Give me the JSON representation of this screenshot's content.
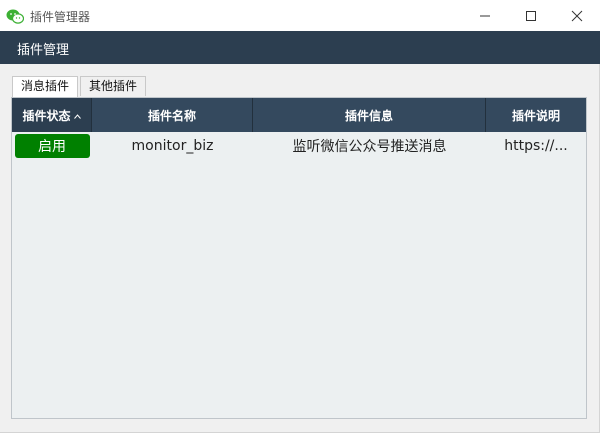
{
  "window": {
    "title": "插件管理器",
    "icon": "wechat-icon",
    "controls": [
      "minimize-icon",
      "maximize-icon",
      "close-icon"
    ]
  },
  "header": {
    "title": "插件管理"
  },
  "tabs": [
    {
      "label": "消息插件",
      "active": true
    },
    {
      "label": "其他插件",
      "active": false
    }
  ],
  "table": {
    "columns": [
      {
        "label": "插件状态",
        "sorted": "ascending"
      },
      {
        "label": "插件名称"
      },
      {
        "label": "插件信息"
      },
      {
        "label": "插件说明"
      }
    ],
    "rows": [
      {
        "status": "启用",
        "name": "monitor_biz",
        "info": "监听微信公众号推送消息",
        "description": "https://..."
      }
    ]
  },
  "colors": {
    "header_bg": "#2c3e50",
    "table_header_bg": "#34495e",
    "enabled_button": "#008000",
    "table_body_bg": "#ecf0f1"
  }
}
